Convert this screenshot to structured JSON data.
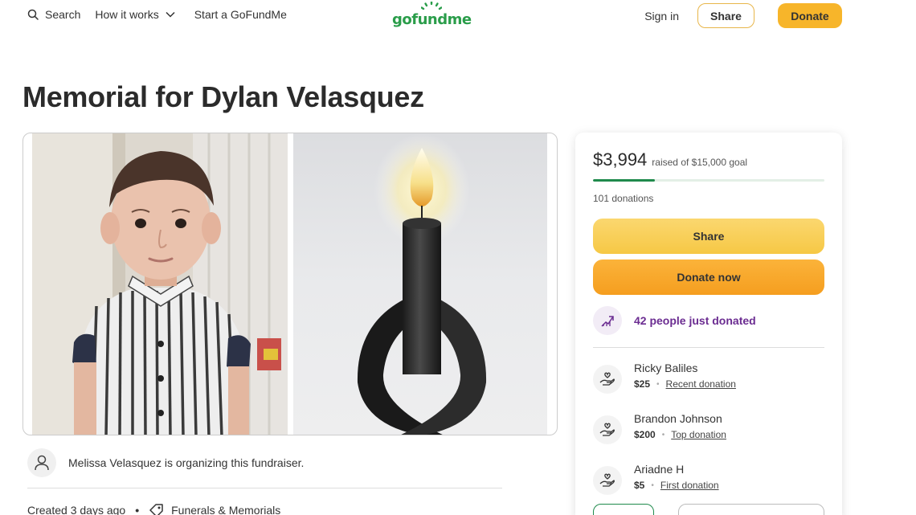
{
  "header": {
    "search_label": "Search",
    "how_label": "How it works",
    "start_label": "Start a GoFundMe",
    "logo_text": "gofundme",
    "signin_label": "Sign in",
    "share_label": "Share",
    "donate_label": "Donate"
  },
  "page": {
    "title": "Memorial for Dylan Velasquez"
  },
  "organizer": {
    "text": "Melissa Velasquez is organizing this fundraiser."
  },
  "meta": {
    "created": "Created 3 days ago",
    "category": "Funerals & Memorials"
  },
  "panel": {
    "raised": "$3,994",
    "goal_text": "raised of $15,000 goal",
    "progress_fraction": 0.266,
    "donations": "101 donations",
    "share_label": "Share",
    "donate_label": "Donate now",
    "trending_text": "42 people just donated",
    "donors": [
      {
        "name": "Ricky Baliles",
        "amount": "$25",
        "tag": "Recent donation"
      },
      {
        "name": "Brandon Johnson",
        "amount": "$200",
        "tag": "Top donation"
      },
      {
        "name": "Ariadne H",
        "amount": "$5",
        "tag": "First donation"
      }
    ]
  },
  "colors": {
    "brand_green": "#2a9d4a",
    "progress_green": "#1f8a4c",
    "accent_yellow": "#f7b52a",
    "trend_purple": "#6b2c91"
  },
  "icons": {
    "search": "search-icon",
    "chevron": "chevron-down-icon",
    "user": "user-icon",
    "tag": "tag-icon",
    "trend": "trending-up-icon",
    "donor": "heart-hand-icon"
  }
}
